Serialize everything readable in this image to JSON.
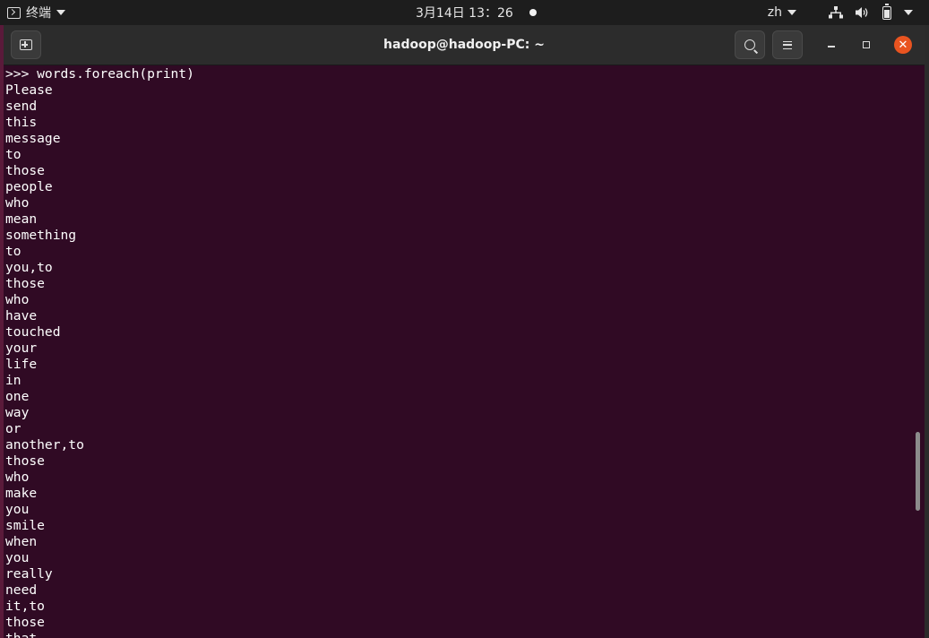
{
  "topbar": {
    "app_menu": "终端",
    "clock": "3月14日  13：26",
    "language": "zh",
    "icons": [
      "terminal-icon",
      "network-icon",
      "volume-icon",
      "battery-icon",
      "system-menu-chevron-icon"
    ]
  },
  "window": {
    "title": "hadoop@hadoop-PC: ~",
    "close_symbol": "✕",
    "accent_color": "#e95420",
    "background_color": "#300a24"
  },
  "terminal": {
    "lines": [
      ">>> words.foreach(print)",
      "Please",
      "send",
      "this",
      "message",
      "to",
      "those",
      "people",
      "who",
      "mean",
      "something",
      "to",
      "you,to",
      "those",
      "who",
      "have",
      "touched",
      "your",
      "life",
      "in",
      "one",
      "way",
      "or",
      "another,to",
      "those",
      "who",
      "make",
      "you",
      "smile",
      "when",
      "you",
      "really",
      "need",
      "it,to",
      "those",
      "that"
    ]
  }
}
